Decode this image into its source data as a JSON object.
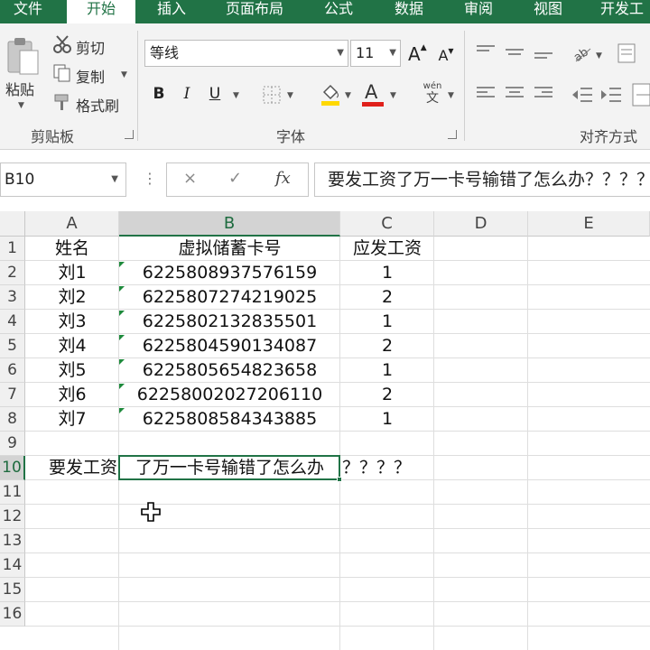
{
  "ribbon_tabs": [
    "文件",
    "开始",
    "插入",
    "页面布局",
    "公式",
    "数据",
    "审阅",
    "视图",
    "开发工"
  ],
  "active_tab": "开始",
  "clipboard": {
    "paste": "粘贴",
    "cut": "剪切",
    "copy": "复制",
    "format_painter": "格式刷",
    "group_label": "剪贴板"
  },
  "font": {
    "name": "等线",
    "size": "11",
    "grow": "A",
    "shrink": "A",
    "bold": "B",
    "italic": "I",
    "underline": "U",
    "font_color": "A",
    "phonetic_top": "wén",
    "phonetic_bottom": "文",
    "group_label": "字体"
  },
  "alignment": {
    "group_label": "对齐方式"
  },
  "formula_bar": {
    "name_box": "B10",
    "cancel": "×",
    "enter": "✓",
    "fx": "fx",
    "content": "要发工资了万一卡号输错了怎么办？？？？？"
  },
  "grid": {
    "columns": [
      "A",
      "B",
      "C",
      "D",
      "E"
    ],
    "selected_column": "B",
    "rows": [
      "1",
      "2",
      "3",
      "4",
      "5",
      "6",
      "7",
      "8",
      "9",
      "10",
      "11",
      "12",
      "13",
      "14",
      "15",
      "16"
    ],
    "selected_row": "10",
    "header": {
      "name": "姓名",
      "card": "虚拟储蓄卡号",
      "pay": "应发工资"
    },
    "records": [
      {
        "name": "刘1",
        "card": "6225808937576159",
        "pay": "1"
      },
      {
        "name": "刘2",
        "card": "6225807274219025",
        "pay": "2"
      },
      {
        "name": "刘3",
        "card": "6225802132835501",
        "pay": "1"
      },
      {
        "name": "刘4",
        "card": "6225804590134087",
        "pay": "2"
      },
      {
        "name": "刘5",
        "card": "6225805654823658",
        "pay": "1"
      },
      {
        "name": "刘6",
        "card": "62258002027206110",
        "pay": "2"
      },
      {
        "name": "刘7",
        "card": "6225808584343885",
        "pay": "1"
      }
    ],
    "row10_a": "要发工资",
    "row10_b": "了万一卡号输错了怎么办",
    "row10_overflow": "？？？？"
  },
  "colors": {
    "excel_green": "#217346",
    "error_triangle": "#1e8a3c",
    "font_color_bar": "#e0201b",
    "fill_color_bar": "#ffd800"
  }
}
